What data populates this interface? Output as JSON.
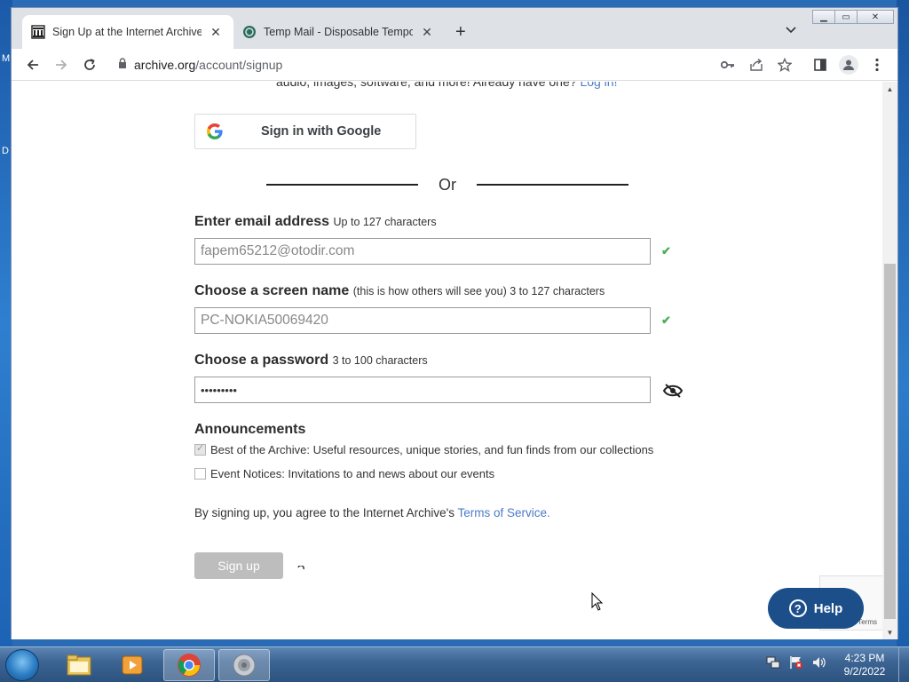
{
  "desktop": {
    "marks": [
      "M",
      "D"
    ]
  },
  "browser": {
    "tabs": [
      {
        "title": "Sign Up at the Internet Archive",
        "favicon": "archive-icon",
        "active": true
      },
      {
        "title": "Temp Mail - Disposable Temporary",
        "favicon": "tempmail-icon",
        "active": false
      }
    ],
    "new_tab": "+",
    "address": {
      "host": "archive.org",
      "path": "/account/signup"
    }
  },
  "page": {
    "intro_text": "audio, images, software, and more! Already have one?",
    "login_link": "Log in!",
    "google_button": "Sign in with Google",
    "or_text": "Or",
    "email": {
      "label": "Enter email address",
      "hint": "Up to 127 characters",
      "value": "fapem65212@otodir.com",
      "valid": "✔"
    },
    "screen_name": {
      "label": "Choose a screen name",
      "hint": "(this is how others will see you) 3 to 127 characters",
      "value": "PC-NOKIA50069420",
      "valid": "✔"
    },
    "password": {
      "label": "Choose a password",
      "hint": "3 to 100 characters",
      "value": "•••••••••"
    },
    "announcements": {
      "title": "Announcements",
      "items": [
        {
          "label": "Best of the Archive: Useful resources, unique stories, and fun finds from our collections",
          "checked": true
        },
        {
          "label": "Event Notices: Invitations to and news about our events",
          "checked": false
        }
      ]
    },
    "terms_text": "By signing up, you agree to the Internet Archive's",
    "terms_link": "Terms of Service.",
    "signup_button": "Sign up",
    "recaptcha_terms": "Terms",
    "help_button": "Help",
    "help_glyph": "?"
  },
  "taskbar": {
    "clock_time": "4:23 PM",
    "clock_date": "9/2/2022",
    "items": [
      "explorer-icon",
      "media-player-icon",
      "chrome-icon",
      "sound-icon"
    ]
  },
  "colors": {
    "link": "#4a7bc8",
    "help": "#1c4f8a",
    "valid": "#4caf50"
  }
}
